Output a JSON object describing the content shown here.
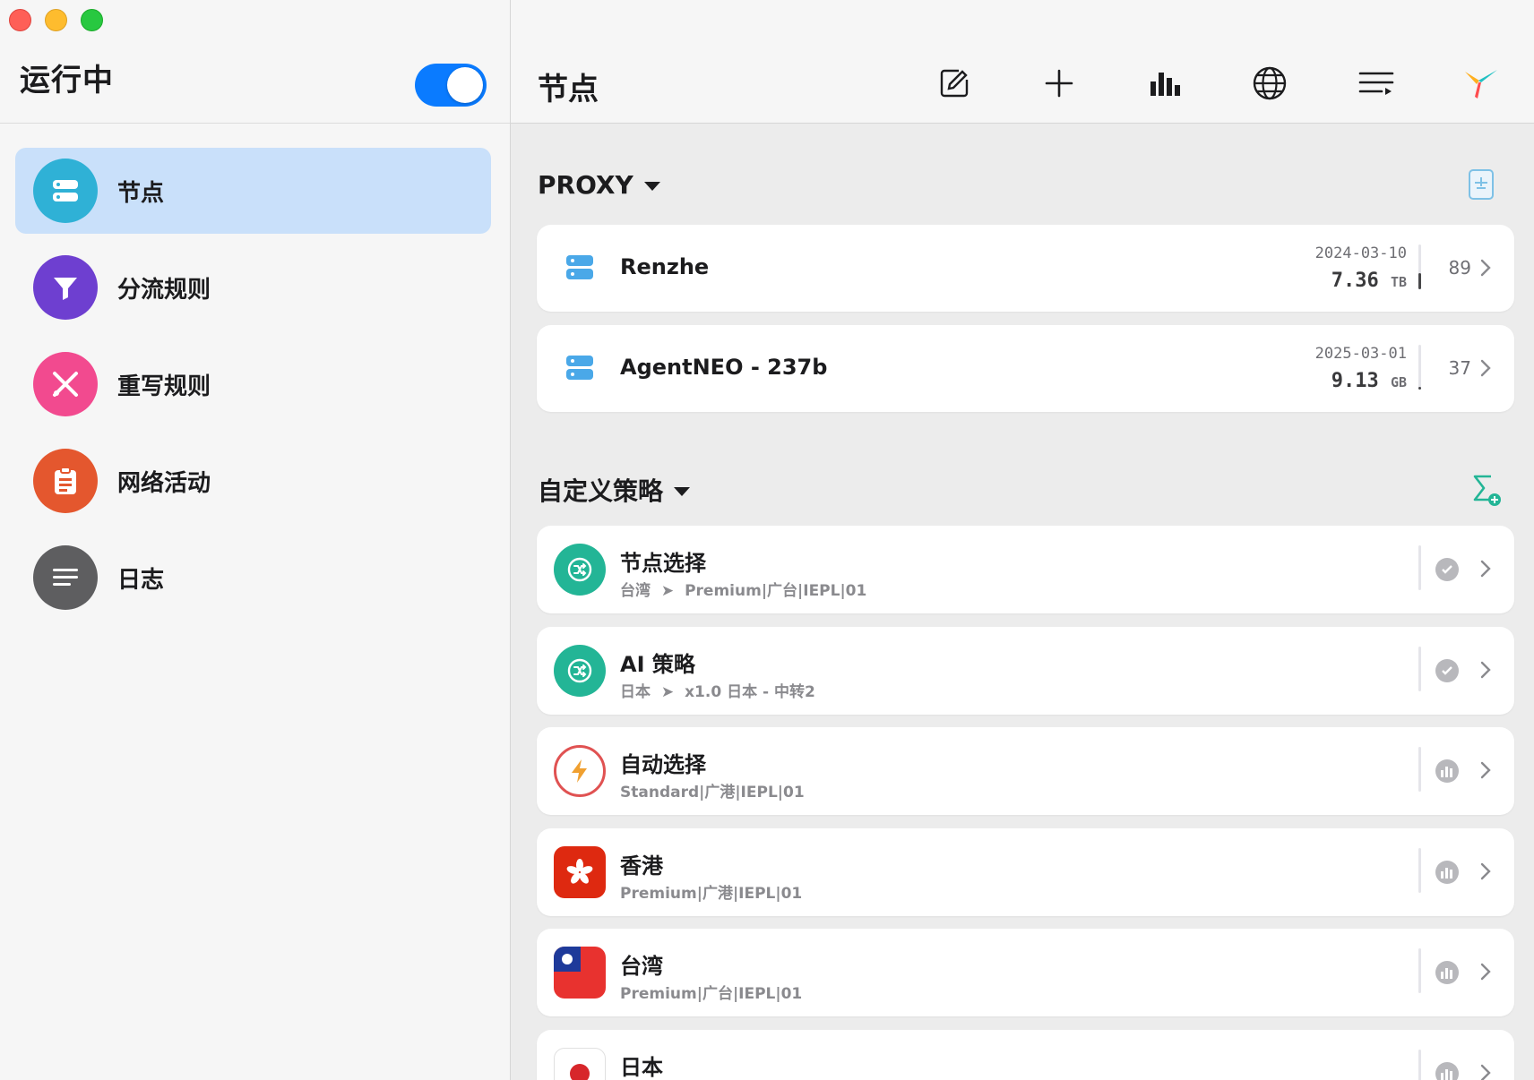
{
  "sidebar": {
    "status_title": "运行中",
    "toggle_on": true,
    "items": [
      {
        "label": "节点",
        "icon": "server-icon",
        "color": "#2fb1d6",
        "active": true
      },
      {
        "label": "分流规则",
        "icon": "filter-icon",
        "color": "#6e3fd0",
        "active": false
      },
      {
        "label": "重写规则",
        "icon": "scissors-icon",
        "color": "#f24a8f",
        "active": false
      },
      {
        "label": "网络活动",
        "icon": "clipboard-icon",
        "color": "#e4572e",
        "active": false
      },
      {
        "label": "日志",
        "icon": "lines-icon",
        "color": "#5e5e60",
        "active": false
      }
    ]
  },
  "header": {
    "title": "节点",
    "tools": [
      "edit-icon",
      "plus-icon",
      "bar-chart-icon",
      "globe-icon",
      "list-icon",
      "app-logo-icon"
    ]
  },
  "proxy_section": {
    "title": "PROXY",
    "nodes": [
      {
        "name": "Renzhe",
        "date": "2024-03-10",
        "size": "7.36",
        "unit": "TB",
        "count": "89",
        "usage": 0.35
      },
      {
        "name": "AgentNEO - 237b",
        "date": "2025-03-01",
        "size": "9.13",
        "unit": "GB",
        "count": "37",
        "usage": 0.05
      }
    ]
  },
  "policy_section": {
    "title": "自定义策略",
    "policies": [
      {
        "name": "节点选择",
        "path_from": "台湾",
        "path_to": "Premium|广台|IEPL|01",
        "icon": "shuffle-icon",
        "status": "check"
      },
      {
        "name": "AI 策略",
        "path_from": "日本",
        "path_to": "x1.0 日本 - 中转2",
        "icon": "shuffle-icon",
        "status": "check"
      },
      {
        "name": "自动选择",
        "path_from": "",
        "path_to": "Standard|广港|IEPL|01",
        "icon": "bolt-icon",
        "status": "bars"
      },
      {
        "name": "香港",
        "path_from": "",
        "path_to": "Premium|广港|IEPL|01",
        "icon": "hk-flag-icon",
        "status": "bars"
      },
      {
        "name": "台湾",
        "path_from": "",
        "path_to": "Premium|广台|IEPL|01",
        "icon": "tw-flag-icon",
        "status": "bars"
      },
      {
        "name": "日本",
        "path_from": "",
        "path_to": "",
        "icon": "jp-flag-icon",
        "status": "bars"
      }
    ]
  },
  "colors": {
    "accent": "#0a7bff",
    "active_bg": "#c9e0fa",
    "teal": "#23b596"
  }
}
